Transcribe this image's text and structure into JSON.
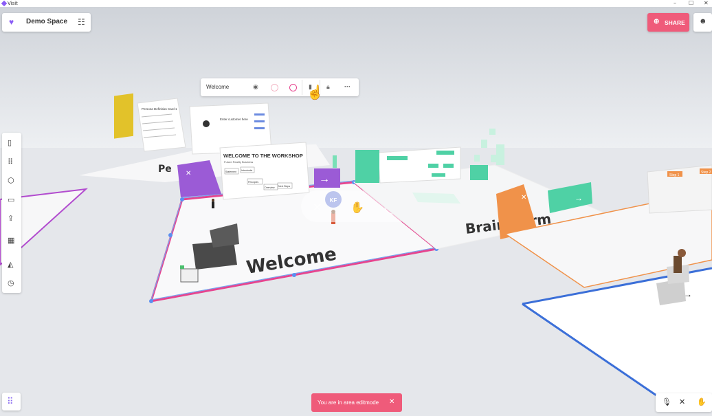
{
  "window": {
    "title": "Visit",
    "controls": [
      "–",
      "☐",
      "✕"
    ]
  },
  "header": {
    "space_name": "Demo Space",
    "share_label": "SHARE"
  },
  "area_toolbar": {
    "area_name": "Welcome",
    "colors": [
      "#f3b7c6",
      "#e6458f"
    ]
  },
  "left_tools": [
    {
      "icon": "page-icon"
    },
    {
      "icon": "apps-icon"
    },
    {
      "icon": "cube-icon"
    },
    {
      "icon": "presentation-icon"
    },
    {
      "icon": "upload-icon"
    },
    {
      "icon": "template-icon"
    },
    {
      "icon": "area-icon"
    },
    {
      "icon": "timer-icon"
    }
  ],
  "toast": {
    "message": "You are in area editmode"
  },
  "scene": {
    "welcome_area_label": "Welcome",
    "brainstorm_area_label": "Brainstorm",
    "workshop_title": "WELCOME TO THE WORKSHOP",
    "workshop_subtitle": "Future Reality Business",
    "board_buttons": [
      "Statement",
      "Introductie",
      "Principles",
      "Overview",
      "Next Steps"
    ],
    "avatar_initials": "KF",
    "step_tags": [
      "Step 1",
      "Step 2"
    ],
    "poster_title": "Persona Definition Card 1",
    "customer_board_field": "Enter customer here"
  },
  "colors": {
    "accent": "#8a5cf6",
    "share": "#ef5b7a",
    "welcome_border": "#e6458f",
    "area_edit": "#3b6fd8",
    "brainstorm_green": "#4fd1a5",
    "orange": "#f0924a"
  }
}
